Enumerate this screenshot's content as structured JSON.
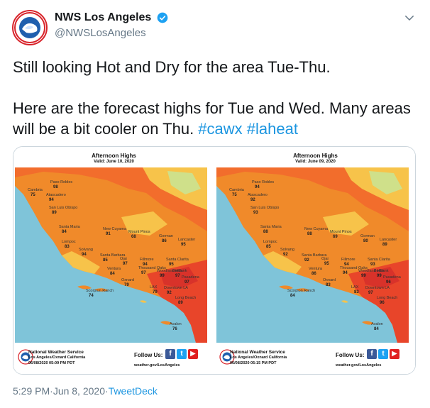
{
  "author": {
    "display_name": "NWS Los Angeles",
    "handle": "@NWSLosAngeles",
    "avatar_text": "NATIONAL WEATHER SERVICE"
  },
  "tweet": {
    "line1": "Still looking Hot and Dry for the area Tue-Thu.",
    "line2": "Here are the forecast highs for Tue and Wed.  Many areas will be a bit cooler on Thu. ",
    "hashtag1": "#cawx",
    "hashtag2": "#laheat",
    "separator": " "
  },
  "maps": [
    {
      "title": "Afternoon Highs",
      "valid": "Valid: June 10, 2020",
      "footer": {
        "org": "National Weather Service",
        "office": "Los Angeles/Oxnard California",
        "issued": "06/08/2020 05:09 PM PDT",
        "follow": "Follow Us:",
        "site": "weather.gov/LosAngeles"
      },
      "temps": [
        {
          "place": "Paso Robles",
          "value": "98"
        },
        {
          "place": "Cambria",
          "value": "75"
        },
        {
          "place": "Atascadero",
          "value": "94"
        },
        {
          "place": "San Luis Obispo",
          "value": "89"
        },
        {
          "place": "Santa Maria",
          "value": "84"
        },
        {
          "place": "New Cuyama",
          "value": "91"
        },
        {
          "place": "Lompoc",
          "value": "83"
        },
        {
          "place": "Solvang",
          "value": "94"
        },
        {
          "place": "Santa Barbara",
          "value": "85"
        },
        {
          "place": "Mount Pinos",
          "value": "68"
        },
        {
          "place": "Ojai",
          "value": "97"
        },
        {
          "place": "Gorman",
          "value": "86"
        },
        {
          "place": "Lancaster",
          "value": "95"
        },
        {
          "place": "Ventura",
          "value": "84"
        },
        {
          "place": "Fillmore",
          "value": "94"
        },
        {
          "place": "Santa Clarita",
          "value": "95"
        },
        {
          "place": "Thousand Oaks",
          "value": "97"
        },
        {
          "place": "Woodland Hills",
          "value": "99"
        },
        {
          "place": "Burbank",
          "value": "97"
        },
        {
          "place": "Pasadena",
          "value": "97"
        },
        {
          "place": "Oxnard",
          "value": "79"
        },
        {
          "place": "LAX",
          "value": "79"
        },
        {
          "place": "Downtown LA",
          "value": "92"
        },
        {
          "place": "Long Beach",
          "value": "89"
        },
        {
          "place": "Scorpion Ranch",
          "value": "74"
        },
        {
          "place": "Avalon",
          "value": "76"
        }
      ]
    },
    {
      "title": "Afternoon Highs",
      "valid": "Valid: June 09, 2020",
      "footer": {
        "org": "National Weather Service",
        "office": "Los Angeles/Oxnard California",
        "issued": "06/08/2020 05:15 PM PDT",
        "follow": "Follow Us:",
        "site": "weather.gov/LosAngeles"
      },
      "temps": [
        {
          "place": "Paso Robles",
          "value": "94"
        },
        {
          "place": "Cambria",
          "value": "75"
        },
        {
          "place": "Atascadero",
          "value": "92"
        },
        {
          "place": "San Luis Obispo",
          "value": "93"
        },
        {
          "place": "Santa Maria",
          "value": "88"
        },
        {
          "place": "New Cuyama",
          "value": "88"
        },
        {
          "place": "Lompoc",
          "value": "85"
        },
        {
          "place": "Solvang",
          "value": "92"
        },
        {
          "place": "Santa Barbara",
          "value": "92"
        },
        {
          "place": "Mount Pinos",
          "value": "69"
        },
        {
          "place": "Ojai",
          "value": "95"
        },
        {
          "place": "Gorman",
          "value": "80"
        },
        {
          "place": "Lancaster",
          "value": "89"
        },
        {
          "place": "Ventura",
          "value": "86"
        },
        {
          "place": "Fillmore",
          "value": "94"
        },
        {
          "place": "Santa Clarita",
          "value": "93"
        },
        {
          "place": "Thousand Oaks",
          "value": "94"
        },
        {
          "place": "Woodland Hills",
          "value": "99"
        },
        {
          "place": "Burbank",
          "value": "99"
        },
        {
          "place": "Pasadena",
          "value": "96"
        },
        {
          "place": "Oxnard",
          "value": "83"
        },
        {
          "place": "LAX",
          "value": "83"
        },
        {
          "place": "Downtown LA",
          "value": "97"
        },
        {
          "place": "Long Beach",
          "value": "96"
        },
        {
          "place": "Scorpion Ranch",
          "value": "84"
        },
        {
          "place": "Avalon",
          "value": "84"
        }
      ]
    }
  ],
  "meta": {
    "time": "5:29 PM",
    "dot": " · ",
    "date": "Jun 8, 2020",
    "source": "TweetDeck"
  },
  "colors": {
    "link": "#1b95e0",
    "hot": "#e8452a",
    "warm": "#f08a2a",
    "mild": "#f7c34a",
    "ocean": "#7fc4d9"
  }
}
